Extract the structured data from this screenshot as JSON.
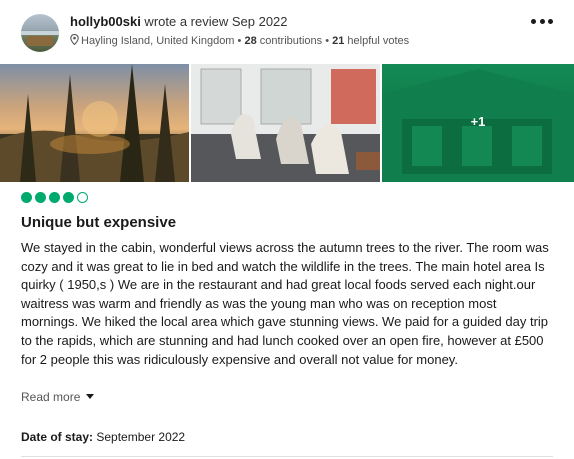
{
  "reviewer": {
    "username": "hollyb00ski",
    "action": " wrote a review Sep 2022",
    "location": "Hayling Island, United Kingdom",
    "contributions_count": "28",
    "contributions_label": " contributions",
    "separator": " • ",
    "helpful_count": "21",
    "helpful_label": " helpful votes"
  },
  "photos": {
    "extra_count_label": "+1"
  },
  "review": {
    "rating": 4,
    "rating_max": 5,
    "title": "Unique but expensive",
    "text": "We stayed in the cabin, wonderful views across the autumn trees to the river. The room was cozy and it was great to lie in bed and watch the wildlife in the trees. The main hotel area Is quirky ( 1950,s ) We are in the restaurant and had great local foods served each night.our waitress was warm and friendly as was the young man who was on reception most mornings. We hiked the local area which gave stunning views. We paid for a guided day trip to the rapids, which are stunning and had lunch cooked over an open fire, however at £500 for 2 people this was ridiculously expensive and overall not value for money.",
    "read_more_label": "Read more",
    "date_of_stay_label": "Date of stay:",
    "date_of_stay_value": " September 2022"
  },
  "colors": {
    "bubble": "#00aa6c",
    "text": "#1a1a1a",
    "muted": "#555555"
  },
  "icons": {
    "location": "map-pin-icon",
    "menu": "more-horizontal-icon",
    "expand": "chevron-down-icon"
  }
}
